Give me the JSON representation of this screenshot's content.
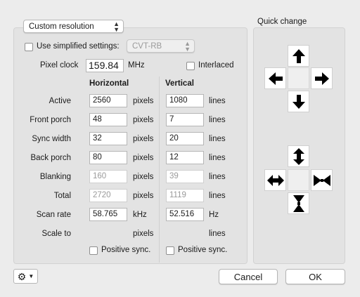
{
  "preset": {
    "selected": "Custom resolution"
  },
  "simplified": {
    "label": "Use simplified settings:",
    "checked": false,
    "option": "CVT-RB"
  },
  "pixel_clock": {
    "label": "Pixel clock",
    "value": "159.84",
    "unit": "MHz"
  },
  "interlaced": {
    "label": "Interlaced",
    "checked": false
  },
  "columns": {
    "horizontal": "Horizontal",
    "vertical": "Vertical"
  },
  "rows": [
    {
      "label": "Active",
      "h": "2560",
      "h_unit": "pixels",
      "v": "1080",
      "v_unit": "lines"
    },
    {
      "label": "Front porch",
      "h": "48",
      "h_unit": "pixels",
      "v": "7",
      "v_unit": "lines"
    },
    {
      "label": "Sync width",
      "h": "32",
      "h_unit": "pixels",
      "v": "20",
      "v_unit": "lines"
    },
    {
      "label": "Back porch",
      "h": "80",
      "h_unit": "pixels",
      "v": "12",
      "v_unit": "lines"
    },
    {
      "label": "Blanking",
      "h": "160",
      "h_unit": "pixels",
      "v": "39",
      "v_unit": "lines"
    },
    {
      "label": "Total",
      "h": "2720",
      "h_unit": "pixels",
      "v": "1119",
      "v_unit": "lines"
    },
    {
      "label": "Scan rate",
      "h": "58.765",
      "h_unit": "kHz",
      "v": "52.516",
      "v_unit": "Hz"
    },
    {
      "label": "Scale to",
      "h": "",
      "h_unit": "pixels",
      "v": "",
      "v_unit": "lines"
    }
  ],
  "positive_sync": {
    "h_label": "Positive sync.",
    "v_label": "Positive sync."
  },
  "quick_change": {
    "title": "Quick change"
  },
  "buttons": {
    "cancel": "Cancel",
    "ok": "OK"
  },
  "colors": {
    "panel_bg": "#e3e3e3",
    "window_bg": "#ececec"
  }
}
